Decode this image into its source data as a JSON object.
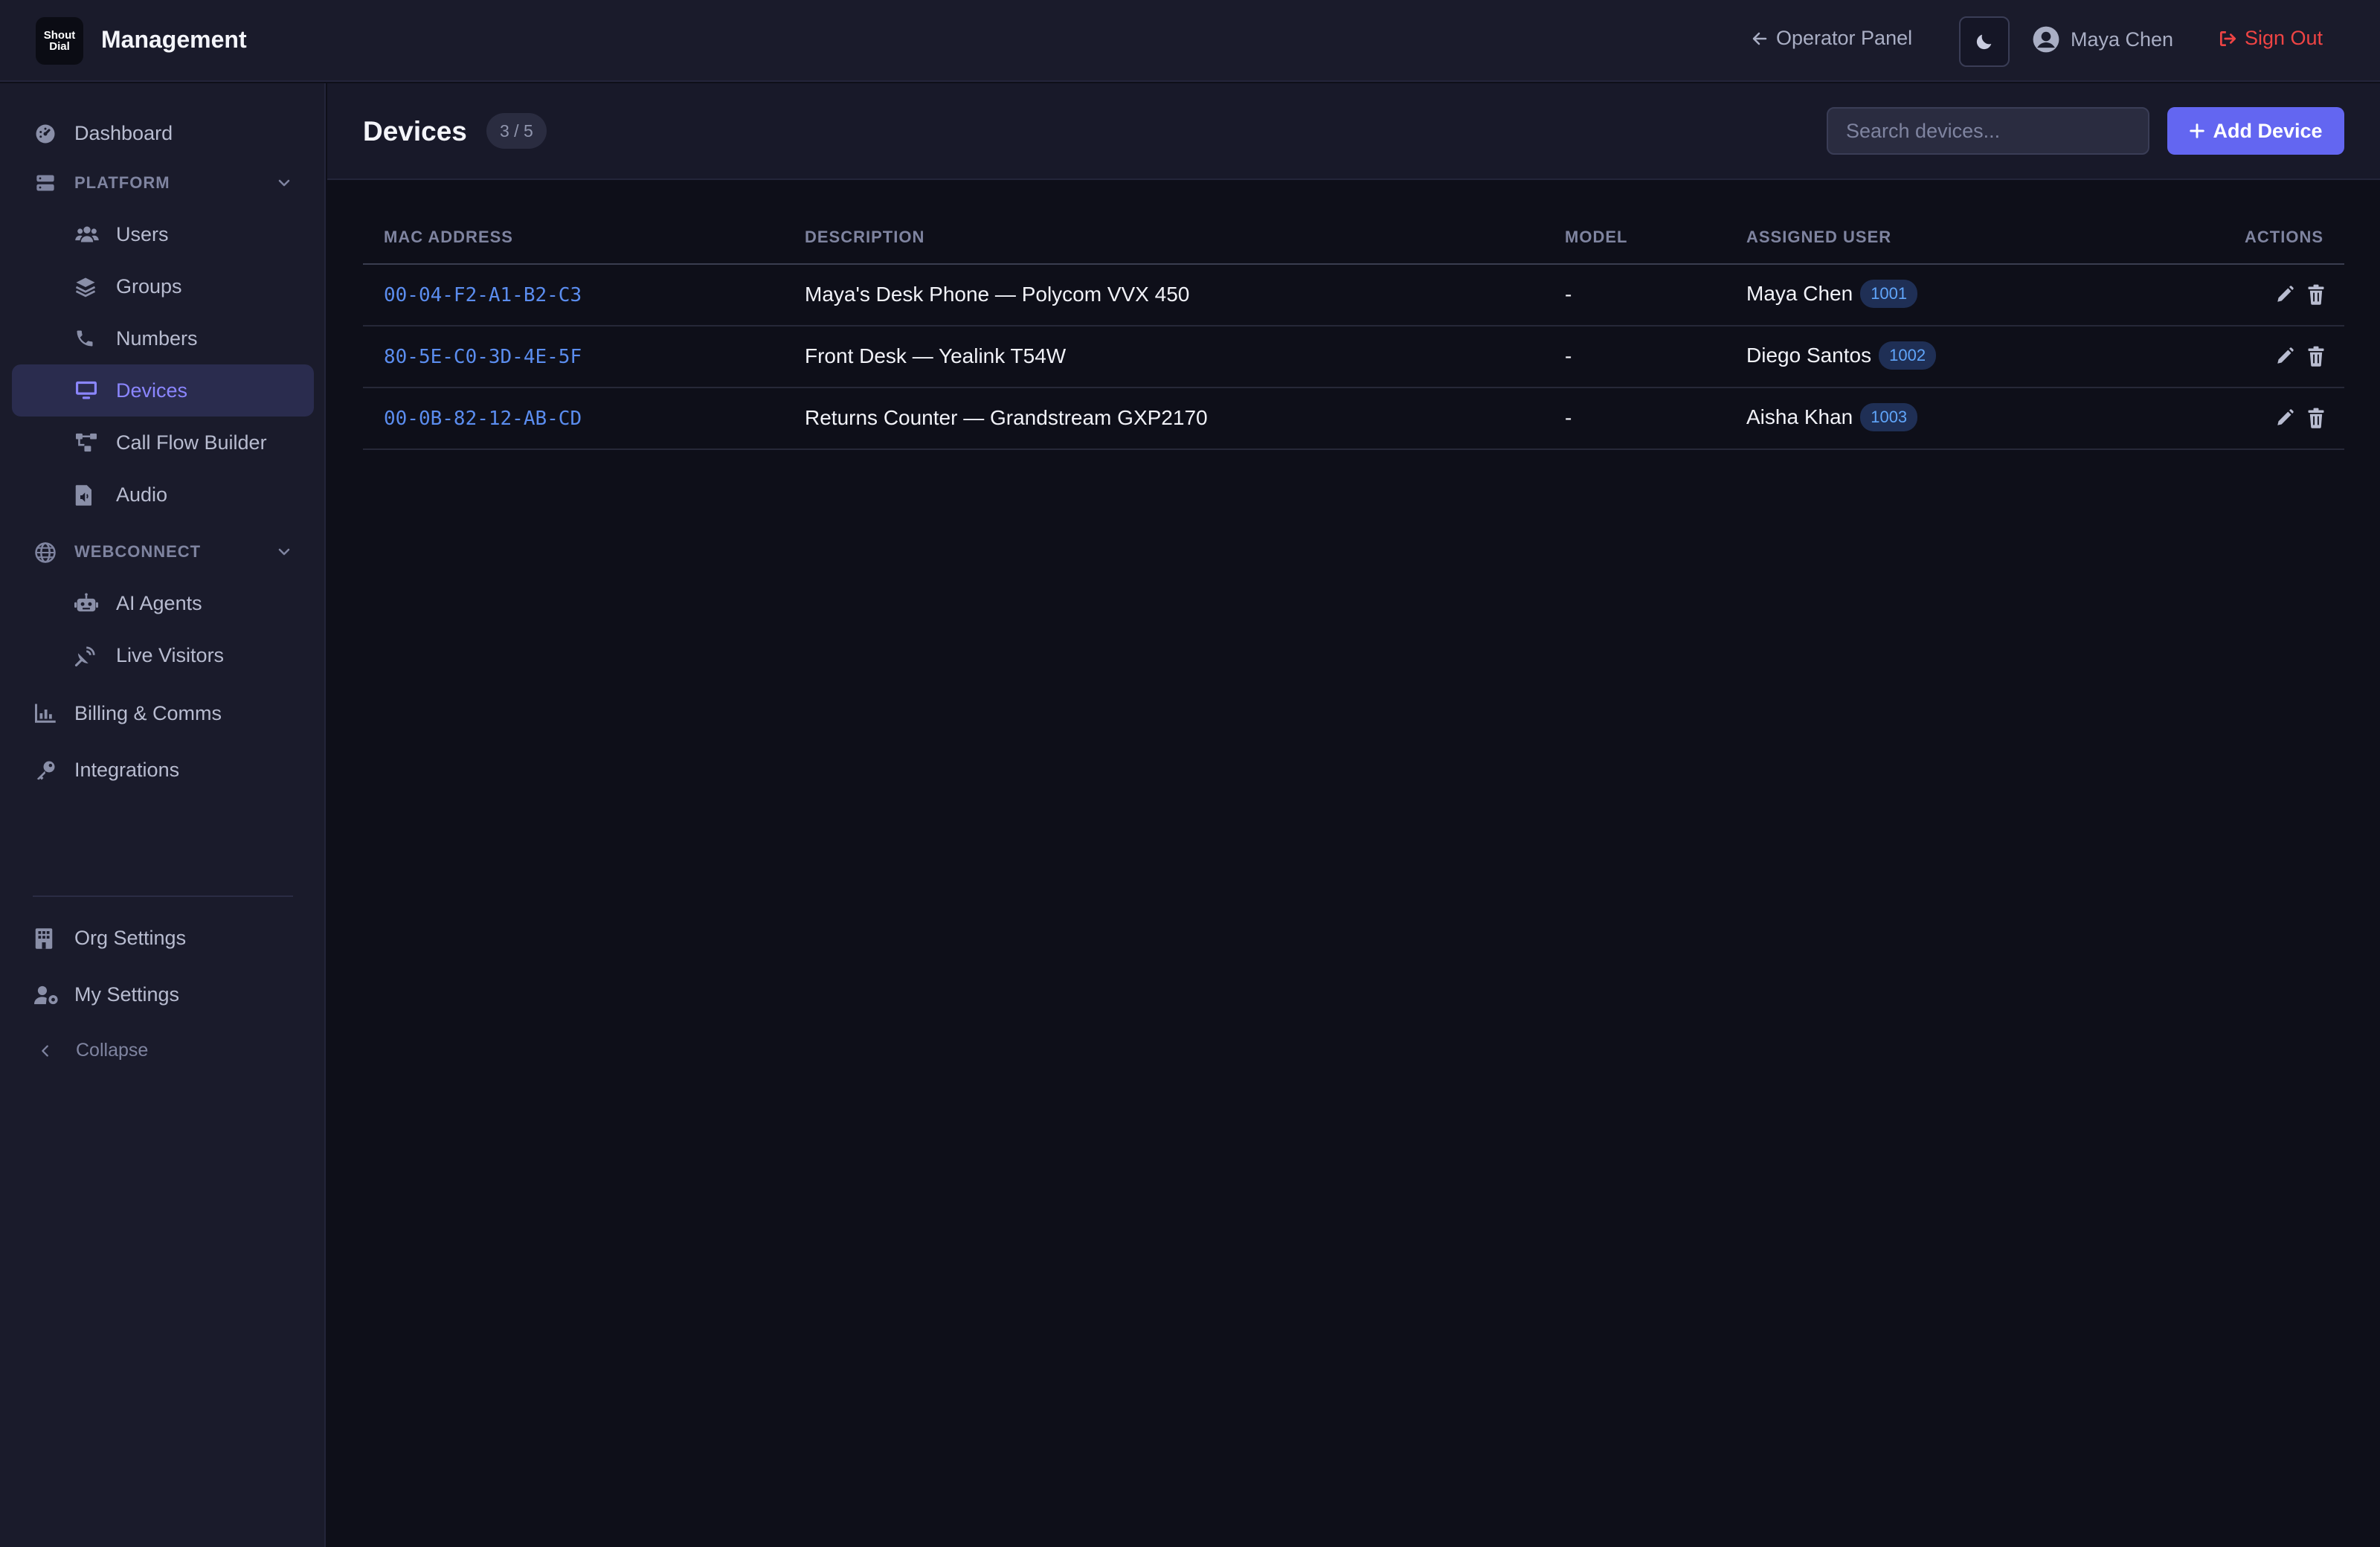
{
  "app": {
    "logo_line1": "Shout",
    "logo_line2": "Dial",
    "title": "Management"
  },
  "topbar": {
    "operator_panel": "Operator Panel",
    "theme_toggle_icon": "moon-icon",
    "user_name": "Maya Chen",
    "sign_out": "Sign Out"
  },
  "sidebar": {
    "dashboard": "Dashboard",
    "platform": {
      "label": "PLATFORM",
      "items": [
        "Users",
        "Groups",
        "Numbers",
        "Devices",
        "Call Flow Builder",
        "Audio"
      ]
    },
    "webconnect": {
      "label": "WEBCONNECT",
      "items": [
        "AI Agents",
        "Live Visitors"
      ]
    },
    "billing": "Billing & Comms",
    "integrations": "Integrations",
    "org_settings": "Org Settings",
    "my_settings": "My Settings",
    "collapse": "Collapse",
    "active_item": "Devices"
  },
  "page": {
    "title": "Devices",
    "count": "3 / 5",
    "search_placeholder": "Search devices...",
    "add_button": "Add Device"
  },
  "table": {
    "columns": [
      "MAC ADDRESS",
      "DESCRIPTION",
      "MODEL",
      "ASSIGNED USER",
      "ACTIONS"
    ],
    "rows": [
      {
        "mac": "00-04-F2-A1-B2-C3",
        "description": "Maya's Desk Phone — Polycom VVX 450",
        "model": "-",
        "user": "Maya Chen",
        "ext": "1001"
      },
      {
        "mac": "80-5E-C0-3D-4E-5F",
        "description": "Front Desk — Yealink T54W",
        "model": "-",
        "user": "Diego Santos",
        "ext": "1002"
      },
      {
        "mac": "00-0B-82-12-AB-CD",
        "description": "Returns Counter — Grandstream GXP2170",
        "model": "-",
        "user": "Aisha Khan",
        "ext": "1003"
      }
    ]
  },
  "colors": {
    "accent": "#6366f1",
    "active_nav_text": "#8b86ff",
    "mac_link": "#5b8def",
    "danger": "#ef4444",
    "background": "#0e0f19",
    "panel": "#1a1b2b"
  }
}
